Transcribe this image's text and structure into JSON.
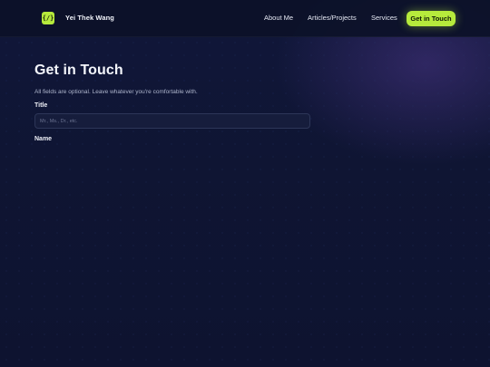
{
  "header": {
    "logo_glyph": "{/}",
    "brand_name": "Yei Thek Wang",
    "nav": {
      "about": "About Me",
      "articles": "Articles/Projects",
      "services": "Services",
      "cta": "Get in Touch"
    }
  },
  "main": {
    "title": "Get in Touch",
    "subtitle": "All fields are optional. Leave whatever you're comfortable with.",
    "fields": {
      "title_label": "Title",
      "title_placeholder": "Mr., Ms., Dr., etc.",
      "title_value": "",
      "name_label": "Name"
    }
  },
  "colors": {
    "accent": "#b6ea3c",
    "background": "#0f1530",
    "input_bg": "#161d3c"
  }
}
